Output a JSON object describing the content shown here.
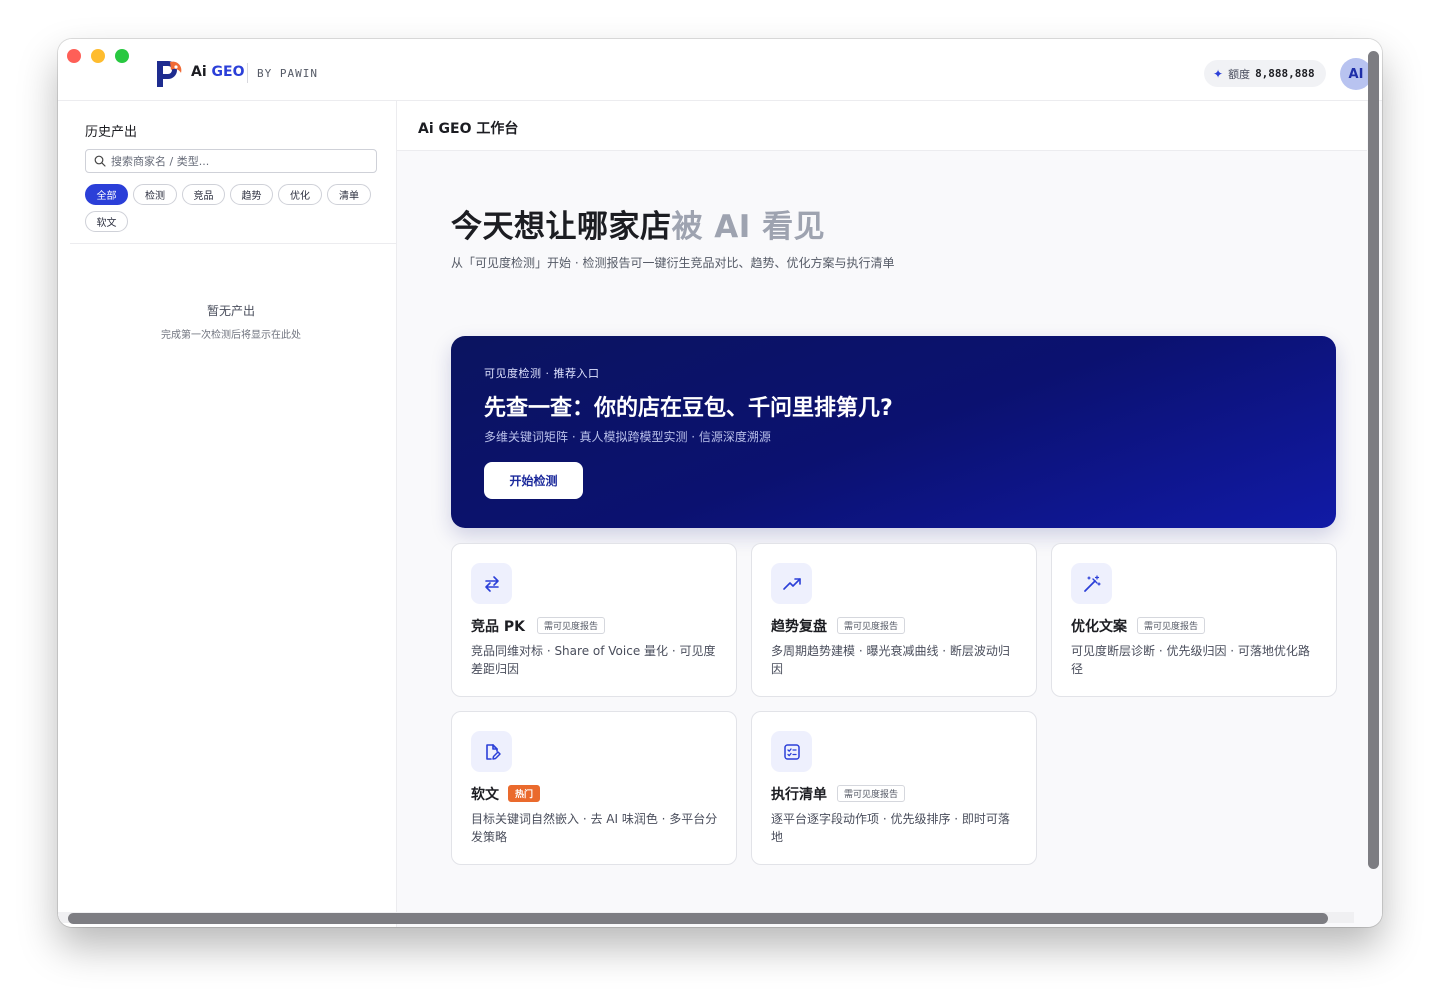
{
  "brand": {
    "name_prefix": "Ai",
    "name_suffix": "GEO",
    "by_line": "BY PAWIN",
    "accent_color": "#2b3fd8"
  },
  "header": {
    "quota_label": "额度",
    "quota_value": "8,888,888",
    "avatar_text": "AI"
  },
  "sidebar": {
    "title": "历史产出",
    "search_placeholder": "搜索商家名 / 类型...",
    "filters": [
      {
        "label": "全部",
        "active": true
      },
      {
        "label": "检测",
        "active": false
      },
      {
        "label": "竞品",
        "active": false
      },
      {
        "label": "趋势",
        "active": false
      },
      {
        "label": "优化",
        "active": false
      },
      {
        "label": "清单",
        "active": false
      },
      {
        "label": "软文",
        "active": false
      }
    ],
    "empty_title": "暂无产出",
    "empty_subtitle": "完成第一次检测后将显示在此处"
  },
  "main": {
    "title": "Ai GEO 工作台",
    "hero_title_main": "今天想让哪家店",
    "hero_title_muted": "被 AI 看见",
    "hero_subtitle": "从「可见度检测」开始 · 检测报告可一键衍生竞品对比、趋势、优化方案与执行清单",
    "banner": {
      "tag": "可见度检测  ·  推荐入口",
      "title": "先查一查：你的店在豆包、千问里排第几?",
      "subtitle": "多维关键词矩阵 · 真人模拟跨模型实测 · 信源深度溯源",
      "button_label": "开始检测"
    },
    "cards": [
      {
        "title": "竞品 PK",
        "badge": "需可见度报告",
        "badge_hot": false,
        "description": "竞品同维对标 · Share of Voice 量化 · 可见度差距归因",
        "icon": "swap-arrows-icon"
      },
      {
        "title": "趋势复盘",
        "badge": "需可见度报告",
        "badge_hot": false,
        "description": "多周期趋势建模 · 曝光衰减曲线 · 断层波动归因",
        "icon": "trend-up-icon"
      },
      {
        "title": "优化文案",
        "badge": "需可见度报告",
        "badge_hot": false,
        "description": "可见度断层诊断 · 优先级归因 · 可落地优化路径",
        "icon": "magic-wand-icon"
      },
      {
        "title": "软文",
        "badge": "热门",
        "badge_hot": true,
        "description": "目标关键词自然嵌入 · 去 AI 味润色 · 多平台分发策略",
        "icon": "edit-document-icon"
      },
      {
        "title": "执行清单",
        "badge": "需可见度报告",
        "badge_hot": false,
        "description": "逐平台逐字段动作项 · 优先级排序 · 即时可落地",
        "icon": "checklist-icon"
      }
    ]
  }
}
